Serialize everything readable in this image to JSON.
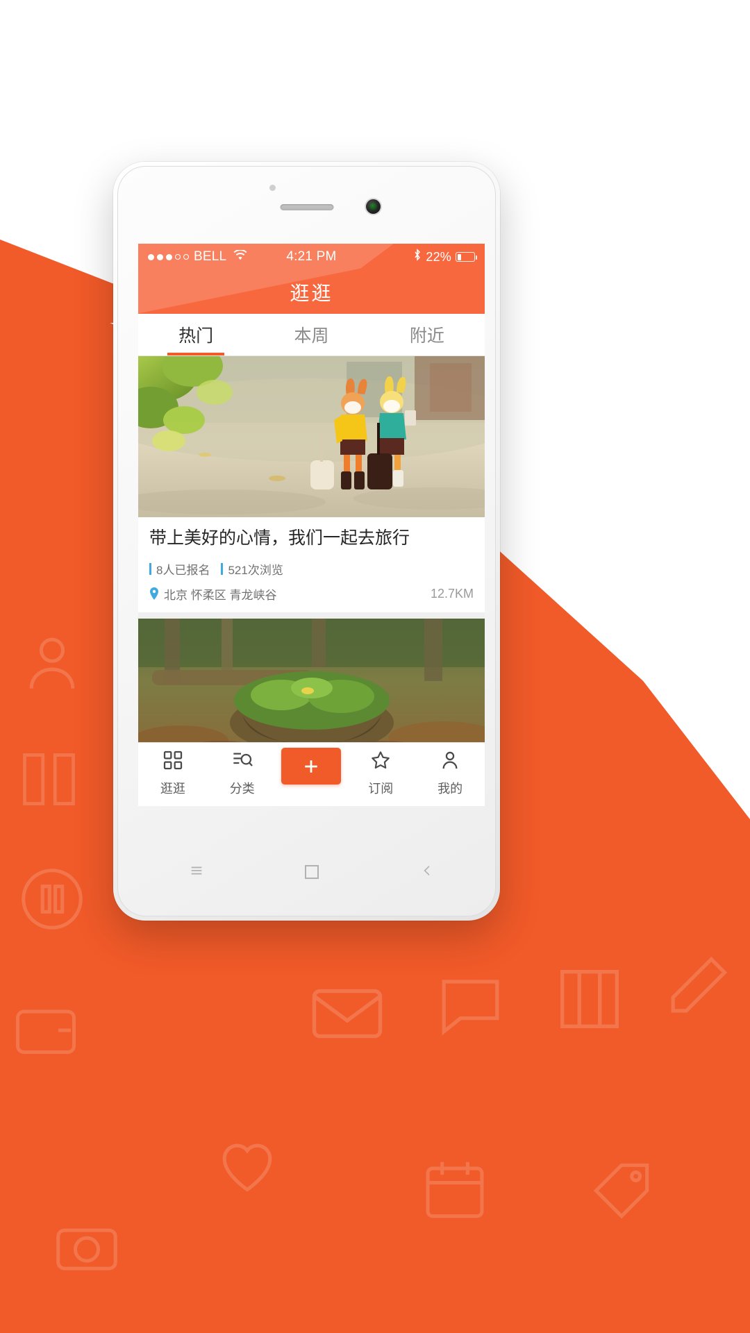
{
  "theme": {
    "accent": "#f15a29",
    "status_bar_bg": "#f8683f",
    "meta_bar_color": "#3fa9e0",
    "text_primary": "#262626",
    "text_secondary": "#707070"
  },
  "status_bar": {
    "signal_dots_filled": 3,
    "signal_dots_total": 5,
    "carrier": "BELL",
    "wifi_icon": "wifi-icon",
    "time": "4:21 PM",
    "bluetooth_icon": "bluetooth-icon",
    "battery_percent": "22%",
    "battery_level": 22
  },
  "app": {
    "title": "逛逛"
  },
  "tabs": [
    {
      "label": "热门",
      "active": true
    },
    {
      "label": "本周",
      "active": false
    },
    {
      "label": "附近",
      "active": false
    }
  ],
  "feed": [
    {
      "image_alt": "two toy rabbits with suitcases on a sunny street",
      "title": "带上美好的心情，我们一起去旅行",
      "signups": "8人已报名",
      "views": "521次浏览",
      "location_icon": "location-pin-icon",
      "location": "北京  怀柔区  青龙峡谷",
      "distance": "12.7KM"
    },
    {
      "image_alt": "mossy tree stump in autumn forest",
      "title": "",
      "signups": "",
      "views": "",
      "location": "",
      "distance": ""
    }
  ],
  "bottom_nav": [
    {
      "icon": "grid-browse-icon",
      "label": "逛逛",
      "active": true
    },
    {
      "icon": "category-search-icon",
      "label": "分类",
      "active": false
    },
    {
      "icon": "plus-icon",
      "label": "",
      "active": false,
      "is_primary": true
    },
    {
      "icon": "star-icon",
      "label": "订阅",
      "active": false
    },
    {
      "icon": "person-icon",
      "label": "我的",
      "active": false
    }
  ],
  "soft_keys": [
    {
      "icon": "menu-icon"
    },
    {
      "icon": "home-icon"
    },
    {
      "icon": "back-icon"
    }
  ]
}
